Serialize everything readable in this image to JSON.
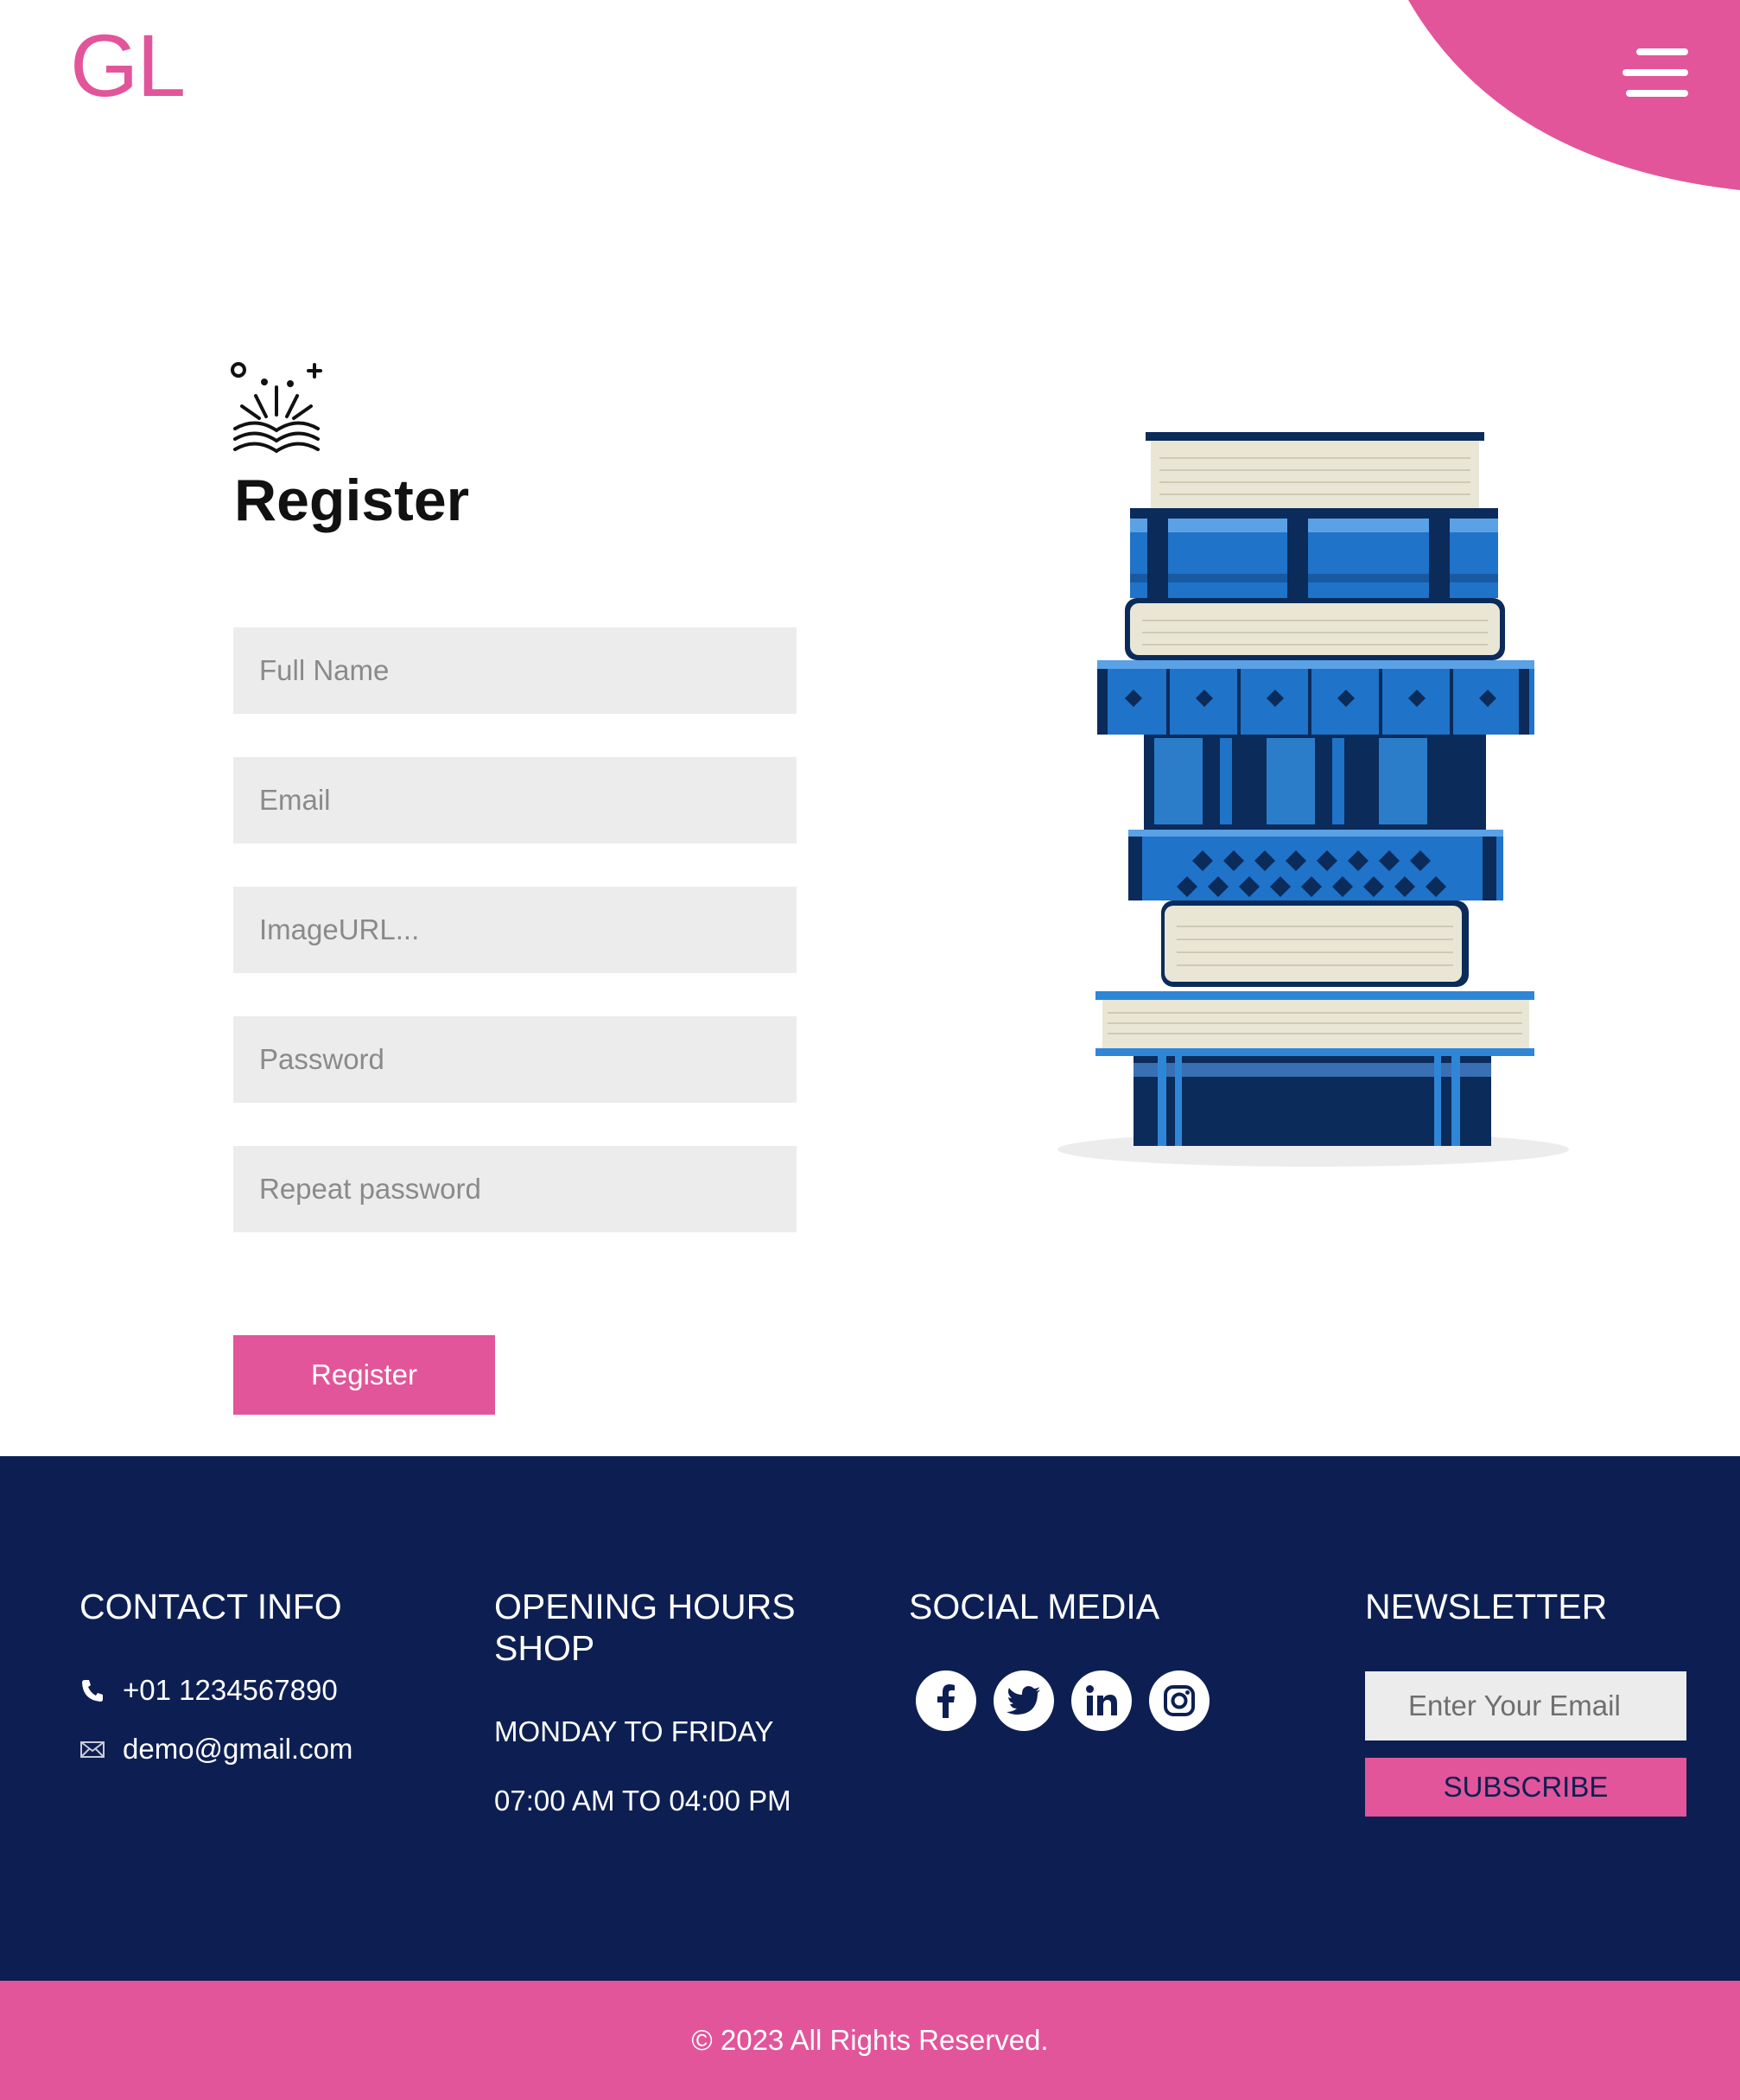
{
  "header": {
    "logo": "GL"
  },
  "form": {
    "title": "Register",
    "fields": [
      {
        "placeholder": "Full Name"
      },
      {
        "placeholder": "Email"
      },
      {
        "placeholder": "ImageURL..."
      },
      {
        "placeholder": "Password"
      },
      {
        "placeholder": "Repeat password"
      }
    ],
    "submit_label": "Register"
  },
  "footer": {
    "contact": {
      "heading": "CONTACT INFO",
      "phone": "+01 1234567890",
      "email": "demo@gmail.com"
    },
    "hours": {
      "heading": "OPENING HOURS SHOP",
      "days": "MONDAY TO FRIDAY",
      "time": "07:00 AM TO 04:00 PM"
    },
    "social": {
      "heading": "SOCIAL MEDIA",
      "icons": [
        "facebook-icon",
        "twitter-icon",
        "linkedin-icon",
        "instagram-icon"
      ]
    },
    "newsletter": {
      "heading": "NEWSLETTER",
      "placeholder": "Enter Your Email",
      "button_label": "SUBSCRIBE"
    },
    "copyright": "© 2023 All Rights Reserved."
  },
  "colors": {
    "brand_pink": "#e2559a",
    "footer_navy": "#0d1f52",
    "input_gray": "#ececec"
  }
}
